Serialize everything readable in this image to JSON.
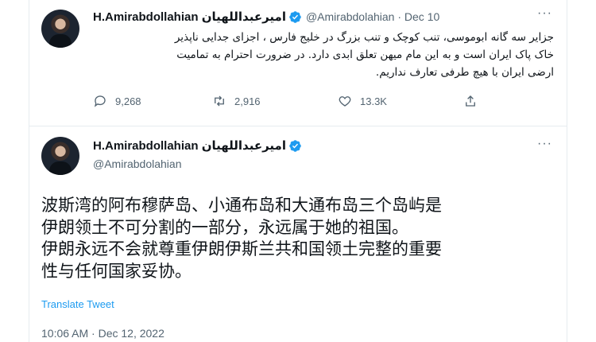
{
  "reply_tweet": {
    "display_name": "H.Amirabdollahian امیرعبداللهیان",
    "handle_date": "@Amirabdolahian · Dec 10",
    "text_lines": [
      "جزایر سه گانه ابوموسی، تنب کوچک و تنب بزرگ در خلیج فارس ، اجزای جدایی ناپذیر",
      "خاک پاک ایران است و به این مام میهن تعلق ابدی دارد. در ضرورت احترام به تمامیت",
      "ارضی ایران با هیچ طرفی تعارف نداریم."
    ],
    "replies": "9,268",
    "retweets": "2,916",
    "likes": "13.3K",
    "icons": [
      "reply-icon",
      "retweet-icon",
      "like-icon",
      "share-icon",
      "more-icon",
      "verified-badge-icon"
    ]
  },
  "main_tweet": {
    "display_name": "H.Amirabdollahian امیرعبداللهیان",
    "handle": "@Amirabdolahian",
    "text_lines": [
      "波斯湾的阿布穆萨岛、小通布岛和大通布岛三个岛屿是",
      "伊朗领土不可分割的一部分，永远属于她的祖国。",
      "伊朗永远不会就尊重伊朗伊斯兰共和国领土完整的重要",
      "性与任何国家妥协。"
    ],
    "translate_label": "Translate Tweet",
    "timestamp": "10:06 AM · Dec 12, 2022"
  },
  "colors": {
    "accent": "#1d9bf0",
    "secondary_text": "#536471",
    "divider": "#e6ecf0"
  }
}
